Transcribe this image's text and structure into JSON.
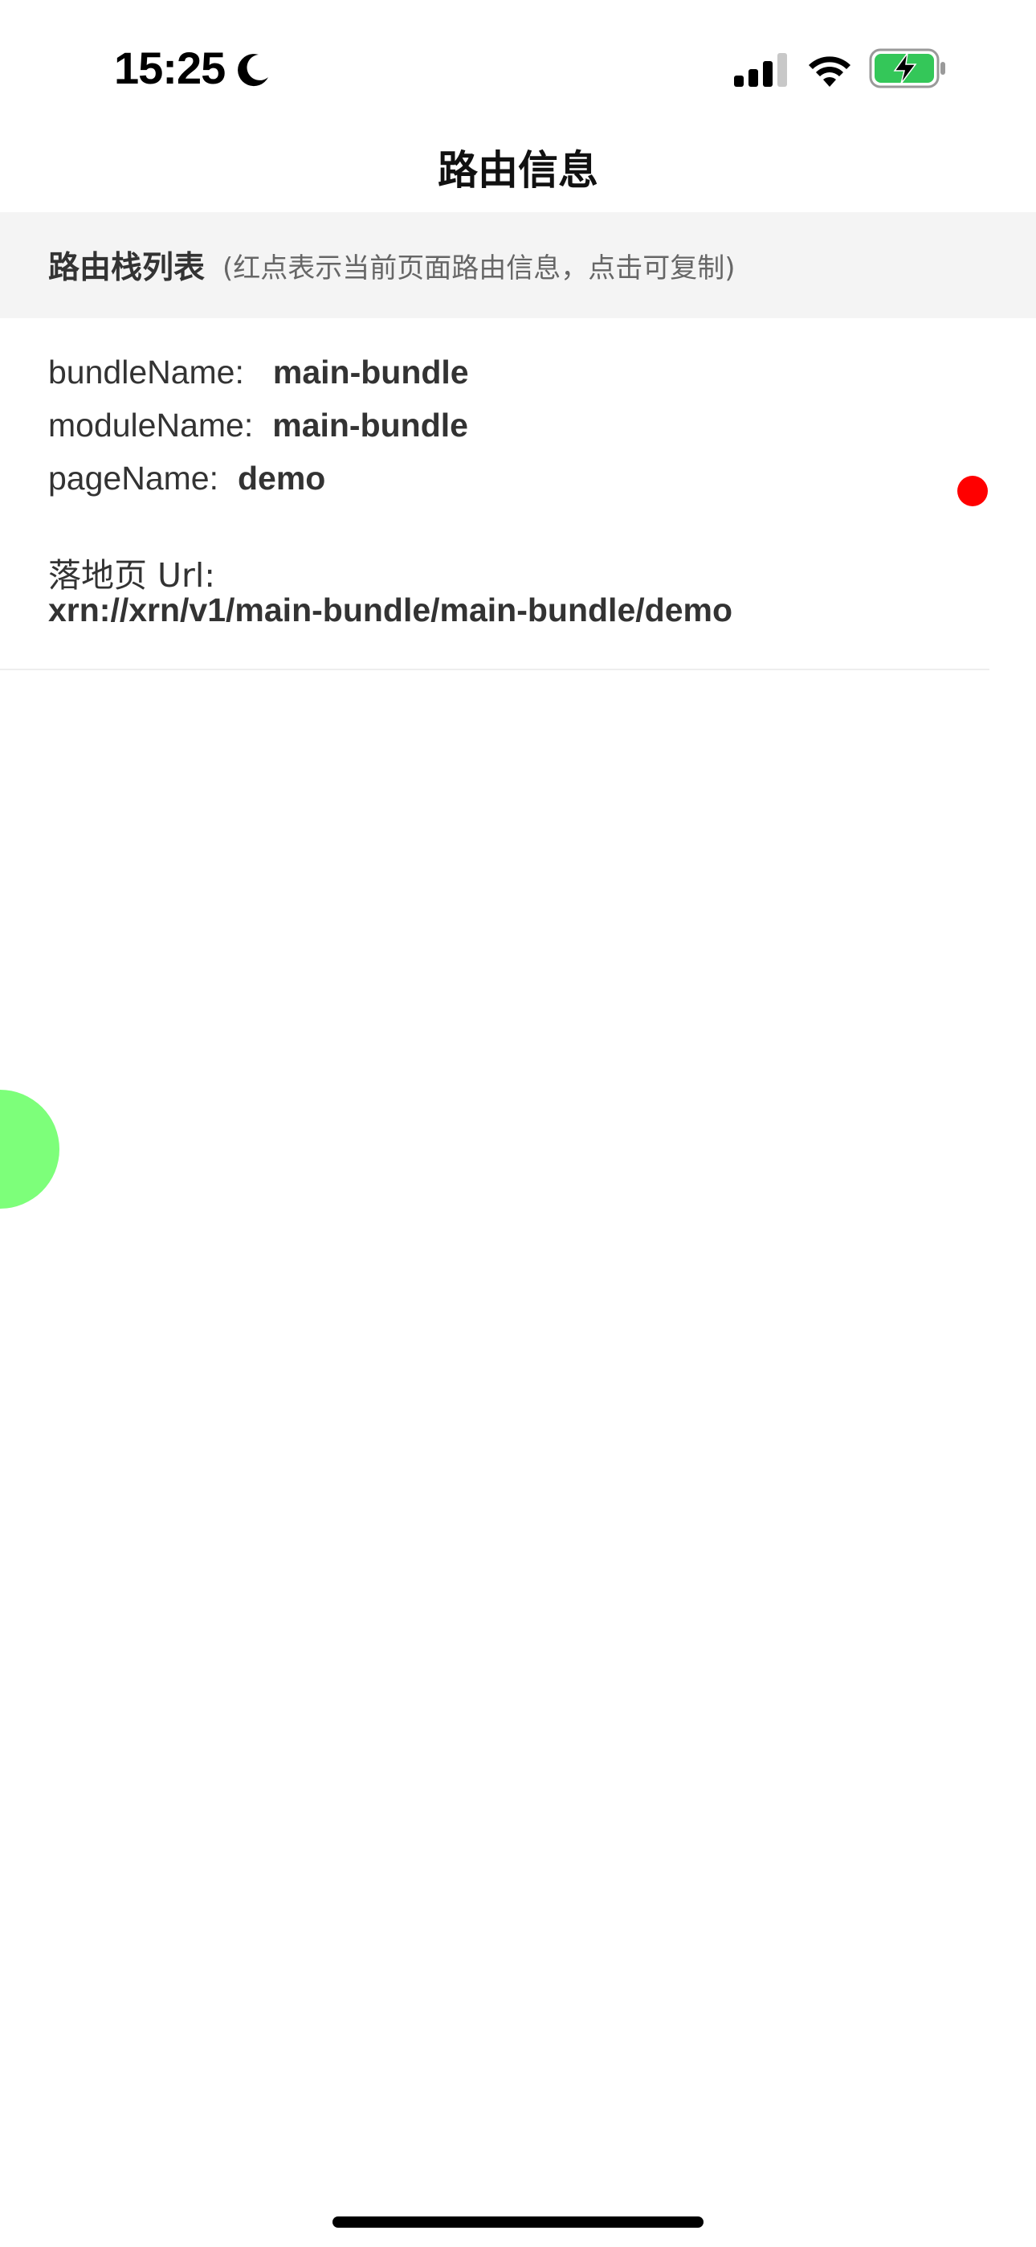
{
  "status_bar": {
    "time": "15:25",
    "icons": [
      "moon-icon",
      "signal-icon",
      "wifi-icon",
      "battery-charging-icon"
    ],
    "battery_color": "#34c759"
  },
  "nav": {
    "title": "路由信息"
  },
  "section": {
    "title": "路由栈列表",
    "hint": "(红点表示当前页面路由信息，点击可复制)"
  },
  "route_stack": [
    {
      "bundle_label": "bundleName:",
      "bundle_value": "main-bundle",
      "module_label": "moduleName:",
      "module_value": "main-bundle",
      "page_label": "pageName:",
      "page_value": "demo",
      "url_label": "落地页 Url:",
      "url_value": "xrn://xrn/v1/main-bundle/main-bundle/demo",
      "is_current": true,
      "indicator_color": "#ff0000"
    }
  ],
  "floating_button": {
    "color": "#7dff7a"
  }
}
